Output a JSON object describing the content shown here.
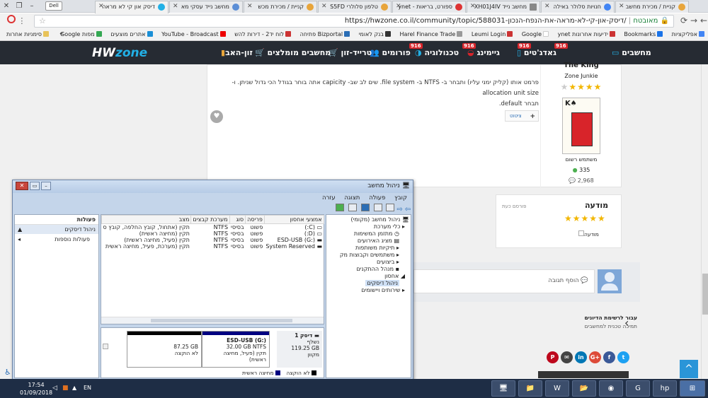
{
  "browser": {
    "tabs": [
      {
        "label": "דיסק און קי לא מראה"
      },
      {
        "label": "מחשב נייד עסקי מא"
      },
      {
        "label": "קניית / מכירת מכש"
      },
      {
        "label": "טלפון סלולרי S5FD"
      },
      {
        "label": "ספורט, בריאות - ynet"
      },
      {
        "label": "מחשב נייד XH01J4IV"
      },
      {
        "label": "חנויות סלולר באילה"
      },
      {
        "label": "קניית / מכירת מחשב"
      }
    ],
    "address": {
      "secure_label": "מאובטח",
      "url": "https://hwzone.co.il/community/topic/588031-דיסק-און-קי-לא-מראה-את-הנפח-הנכון/"
    },
    "bookmarks": [
      "אפליקציות",
      "Bookmarks",
      "ידיעות אחרונות ynet",
      "Google",
      "Leumi Login",
      "Harel Finance Trade",
      "בנק לאומי",
      "Bizportal פתיחה",
      "לוח יד2 - דירות להש",
      "YouTube - Broadcast",
      "אתרים מוצעים",
      "מפות Google"
    ],
    "bookmarks_other": "סימניות אחרות"
  },
  "site": {
    "logo_pre": "HW",
    "logo_post": "zone",
    "nav": [
      {
        "label": "מחשבים",
        "badge": "916"
      },
      {
        "label": "גאדג'טים",
        "badge": "916"
      },
      {
        "label": "גיימינג",
        "badge": "916"
      },
      {
        "label": "טכנולוגיה",
        "badge": "916"
      },
      {
        "label": "פורומים",
        "badge": ""
      },
      {
        "label": "טרייד-זון",
        "badge": ""
      },
      {
        "label": "מחשבים מומלצים",
        "badge": ""
      },
      {
        "label": "זון-האב",
        "badge": ""
      }
    ]
  },
  "post": {
    "body_line1": "פרמט אותו (קליק ימני עליו) ותבחר ב- NTFS ב- file system. שים לב שב- capicity אתה בוחר בגודל הכי גדול שניתן. ו- allocation unit size",
    "body_line2": "תבחר default.",
    "quote_label": "ציטוט",
    "author": "The King",
    "rank": "Zone Junkie",
    "role": "משתמש רשום",
    "reputation": "335",
    "post_count": "2,968",
    "rating": 5
  },
  "ad": {
    "title": "מודעה",
    "time": "פורסם כעת",
    "image_alt": "מודעה",
    "rating": 5
  },
  "reply": {
    "placeholder": "הוסף תגובה"
  },
  "nav_back": {
    "title": "עבור לרשימת הדיונים",
    "subtitle": "תמיכה טכנית למחשבים"
  },
  "diskmgmt": {
    "title": "ניהול מחשב",
    "menu": [
      "קובץ",
      "פעולה",
      "תצוגה",
      "עזרה"
    ],
    "tree": [
      "ניהול מחשב (מקומי)",
      "כלי מערכת",
      "מתזמן המשימות",
      "מציג האירועים",
      "תיקיות משותפות",
      "משתמשים וקבוצות מק",
      "ביצועים",
      "מנהל ההתקנים",
      "אחסון",
      "ניהול דיסקים",
      "שירותים ויישומים"
    ],
    "columns": [
      "אמצעי אחסון",
      "פריסה",
      "סוג",
      "מערכת קבצים",
      "מצב"
    ],
    "volumes": [
      [
        "(C:)",
        "פשוט",
        "בסיסי",
        "NTFS",
        "תקין (אתחול, קובץ החלפה, קובץ ס"
      ],
      [
        "(D:)",
        "פשוט",
        "בסיסי",
        "NTFS",
        "תקין (מחיצה ראשית)"
      ],
      [
        "ESD-USB (G:)",
        "פשוט",
        "בסיסי",
        "NTFS",
        "תקין (פעיל, מחיצה ראשית)"
      ],
      [
        "System Reserved",
        "פשוט",
        "בסיסי",
        "NTFS",
        "תקין (מערכת, פעיל, מחיצה ראשית"
      ]
    ],
    "actions_title": "פעולות",
    "actions": [
      "ניהול דיסקים",
      "פעולות נוספות"
    ],
    "disk": {
      "name": "דיסק 1",
      "type": "נשלף",
      "size": "119.25 GB",
      "status": "מקוון"
    },
    "partitions": [
      {
        "name": "ESD-USB  (G:)",
        "size": "32.00 GB NTFS",
        "status": "תקין (פעיל, מחיצה ראשית)"
      },
      {
        "name": "",
        "size": "87.25 GB",
        "status": "לא הוקצה"
      }
    ],
    "legend": [
      "לא הוקצה",
      "מחיצה ראשית"
    ]
  },
  "taskbar": {
    "time": "17:54",
    "date": "01/09/2018",
    "lang": "EN"
  },
  "colors": {
    "header": "#262b33",
    "accent": "#22b0e6",
    "badge": "#d8242a",
    "taskbar": "#1e2d45",
    "primary_partition": "#000080"
  }
}
